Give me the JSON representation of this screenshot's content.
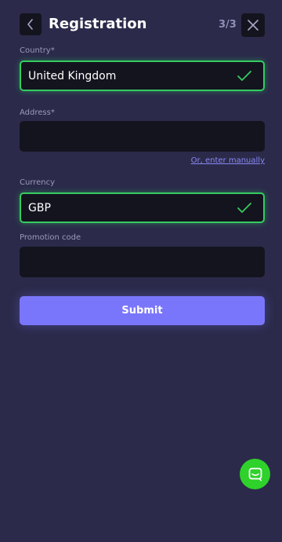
{
  "header": {
    "title": "Registration",
    "step": "3/3"
  },
  "form": {
    "country": {
      "label": "Country*",
      "value": "United Kingdom"
    },
    "address": {
      "label": "Address*",
      "value": ""
    },
    "manual_link": "Or, enter manually",
    "currency": {
      "label": "Currency",
      "value": "GBP"
    },
    "promo": {
      "label": "Promotion code",
      "value": ""
    },
    "submit_label": "Submit"
  },
  "colors": {
    "background": "#2b2a4a",
    "field": "#14141f",
    "valid": "#34cc5f",
    "accent": "#7a76fb",
    "chat": "#2fd12b"
  },
  "icons": {
    "back": "chevron-left-icon",
    "close": "close-icon",
    "valid": "checkmark-icon",
    "chat": "chat-icon"
  }
}
